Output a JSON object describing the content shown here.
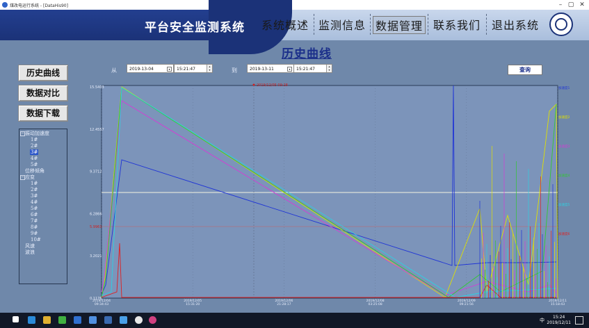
{
  "window": {
    "title": "煤改电运行系统 - [DataHis90]",
    "minimize": "–",
    "maximize": "▢",
    "close": "✕"
  },
  "header": {
    "title": "平台安全监测系统"
  },
  "nav": [
    {
      "label": "系统概述"
    },
    {
      "label": "监测信息"
    },
    {
      "label": "数据管理"
    },
    {
      "label": "联系我们"
    },
    {
      "label": "退出系统"
    }
  ],
  "page_title": "历史曲线",
  "sidebar": {
    "buttons": [
      "历史曲线",
      "数据对比",
      "数据下载"
    ]
  },
  "tree": {
    "group1": "振动加速度",
    "group1_items": [
      "1#",
      "2#",
      "3#",
      "4#",
      "5#"
    ],
    "selected": "3#",
    "item2": "位移倾角",
    "group2": "应变",
    "group2_items": [
      "1#",
      "2#",
      "3#",
      "4#",
      "5#",
      "6#",
      "7#",
      "8#",
      "9#",
      "10#"
    ],
    "item3": "风速",
    "item4": "波浪"
  },
  "filter": {
    "from_label": "从",
    "to_label": "到",
    "from_date": "2019-13-04",
    "from_time": "15:21:47",
    "to_date": "2019-13-11",
    "to_time": "15:21:47",
    "query_label": "查询"
  },
  "chart_data": {
    "type": "line",
    "y_ticks": [
      "15.5403",
      "12.4557",
      "9.3712",
      "6.2866",
      "3.2021",
      "0.1176"
    ],
    "marker_value": "5.9961",
    "x_ticks": [
      "2019/12/04\n09:34:43",
      "2019/12/05\n15:31:20",
      "2019/12/06\n21:28:17",
      "2019/12/08\n03:25:08",
      "2019/12/09\n09:21:56",
      "2019/12/11\n15:18:43"
    ],
    "cursor_label": "2019/12/05 09:28",
    "series_colors": [
      "#1f34d6",
      "#e0e000",
      "#d63bd6",
      "#32c832",
      "#2ed0e0",
      "#e02020"
    ],
    "legend": [
      "加速度1",
      "加速度2",
      "加速度3",
      "加速度4",
      "加速度5",
      "加速度6"
    ]
  },
  "taskbar": {
    "time": "15:24",
    "date": "2019/12/11",
    "lang": "中"
  }
}
